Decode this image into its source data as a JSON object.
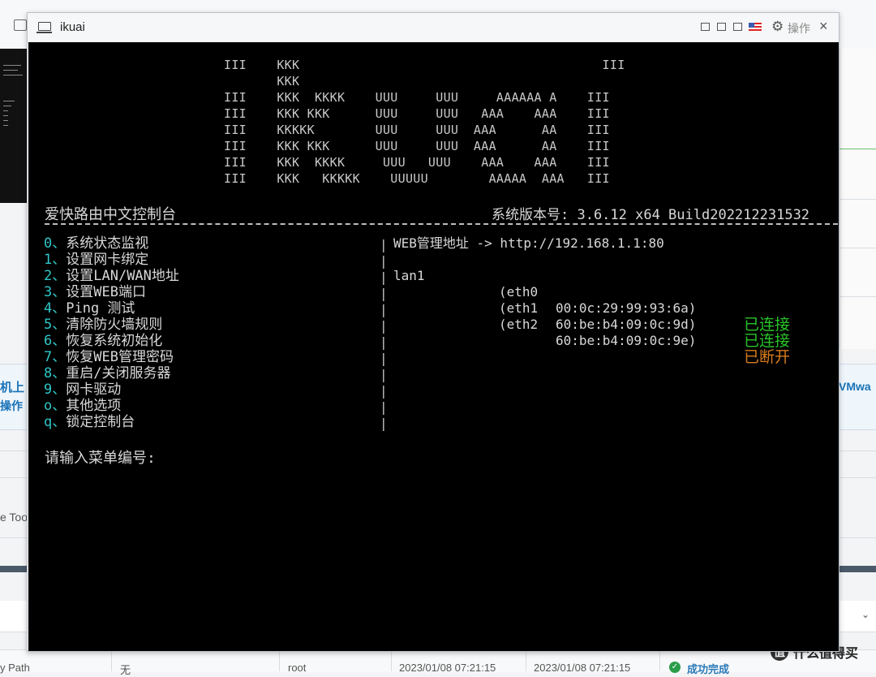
{
  "background": {
    "left_strip_primary": "机上",
    "left_strip_secondary": "操作",
    "right_strip_text": "VMwa",
    "tools_text": "e Too",
    "table_row": {
      "col1": "y Path",
      "col2": "无",
      "col3": "root",
      "col4": "2023/01/08 07:21:15",
      "col5": "2023/01/08 07:21:15",
      "status": "成功完成"
    },
    "watermark": "什么值得买",
    "watermark_logo": "值"
  },
  "window": {
    "title": "ikuai",
    "ops_label": "操作",
    "close_glyph": "×",
    "gear_glyph": "⚙"
  },
  "console": {
    "ascii_art": "III    KKK                                        III\n       KKK\nIII    KKK  KKKK    UUU     UUU     AAAAAA A    III\nIII    KKK KKK      UUU     UUU   AAA    AAA    III\nIII    KKKKK        UUU     UUU  AAA      AA    III\nIII    KKK KKK      UUU     UUU  AAA      AA    III\nIII    KKK  KKKK     UUU   UUU    AAA    AAA    III\nIII    KKK   KKKKK    UUUUU        AAAAA  AAA   III",
    "header_left": "爱快路由中文控制台",
    "header_right": "系统版本号: 3.6.12 x64 Build202212231532",
    "menu": [
      {
        "key": "0、",
        "label": "系统状态监视"
      },
      {
        "key": "1、",
        "label": "设置网卡绑定"
      },
      {
        "key": "2、",
        "label": "设置LAN/WAN地址"
      },
      {
        "key": "3、",
        "label": "设置WEB端口"
      },
      {
        "key": "4、",
        "label": "Ping 测试"
      },
      {
        "key": "5、",
        "label": "清除防火墙规则"
      },
      {
        "key": "6、",
        "label": "恢复系统初始化"
      },
      {
        "key": "7、",
        "label": "恢复WEB管理密码"
      },
      {
        "key": "8、",
        "label": "重启/关闭服务器"
      },
      {
        "key": "9、",
        "label": "网卡驱动"
      },
      {
        "key": "o、",
        "label": "其他选项"
      },
      {
        "key": "q、",
        "label": "锁定控制台"
      }
    ],
    "divider_char": "|",
    "web_addr": "WEB管理地址 -> http://192.168.1.1:80",
    "nics": [
      {
        "name": "lan1",
        "eth": "(eth0",
        "mac": "00:0c:29:99:93:6a)",
        "status": "已连接",
        "status_color": "#28c428"
      },
      {
        "name": "",
        "eth": "(eth1",
        "mac": "60:be:b4:09:0c:9d)",
        "status": "已连接",
        "status_color": "#28c428"
      },
      {
        "name": "",
        "eth": "(eth2",
        "mac": "60:be:b4:09:0c:9e)",
        "status": "已断开",
        "status_color": "#d87c1c"
      }
    ],
    "prompt": "请输入菜单编号:"
  },
  "colors": {
    "menu_key": "#2fc6c6",
    "connected": "#28c428",
    "disconnected": "#d87c1c",
    "console_bg": "#000000"
  }
}
